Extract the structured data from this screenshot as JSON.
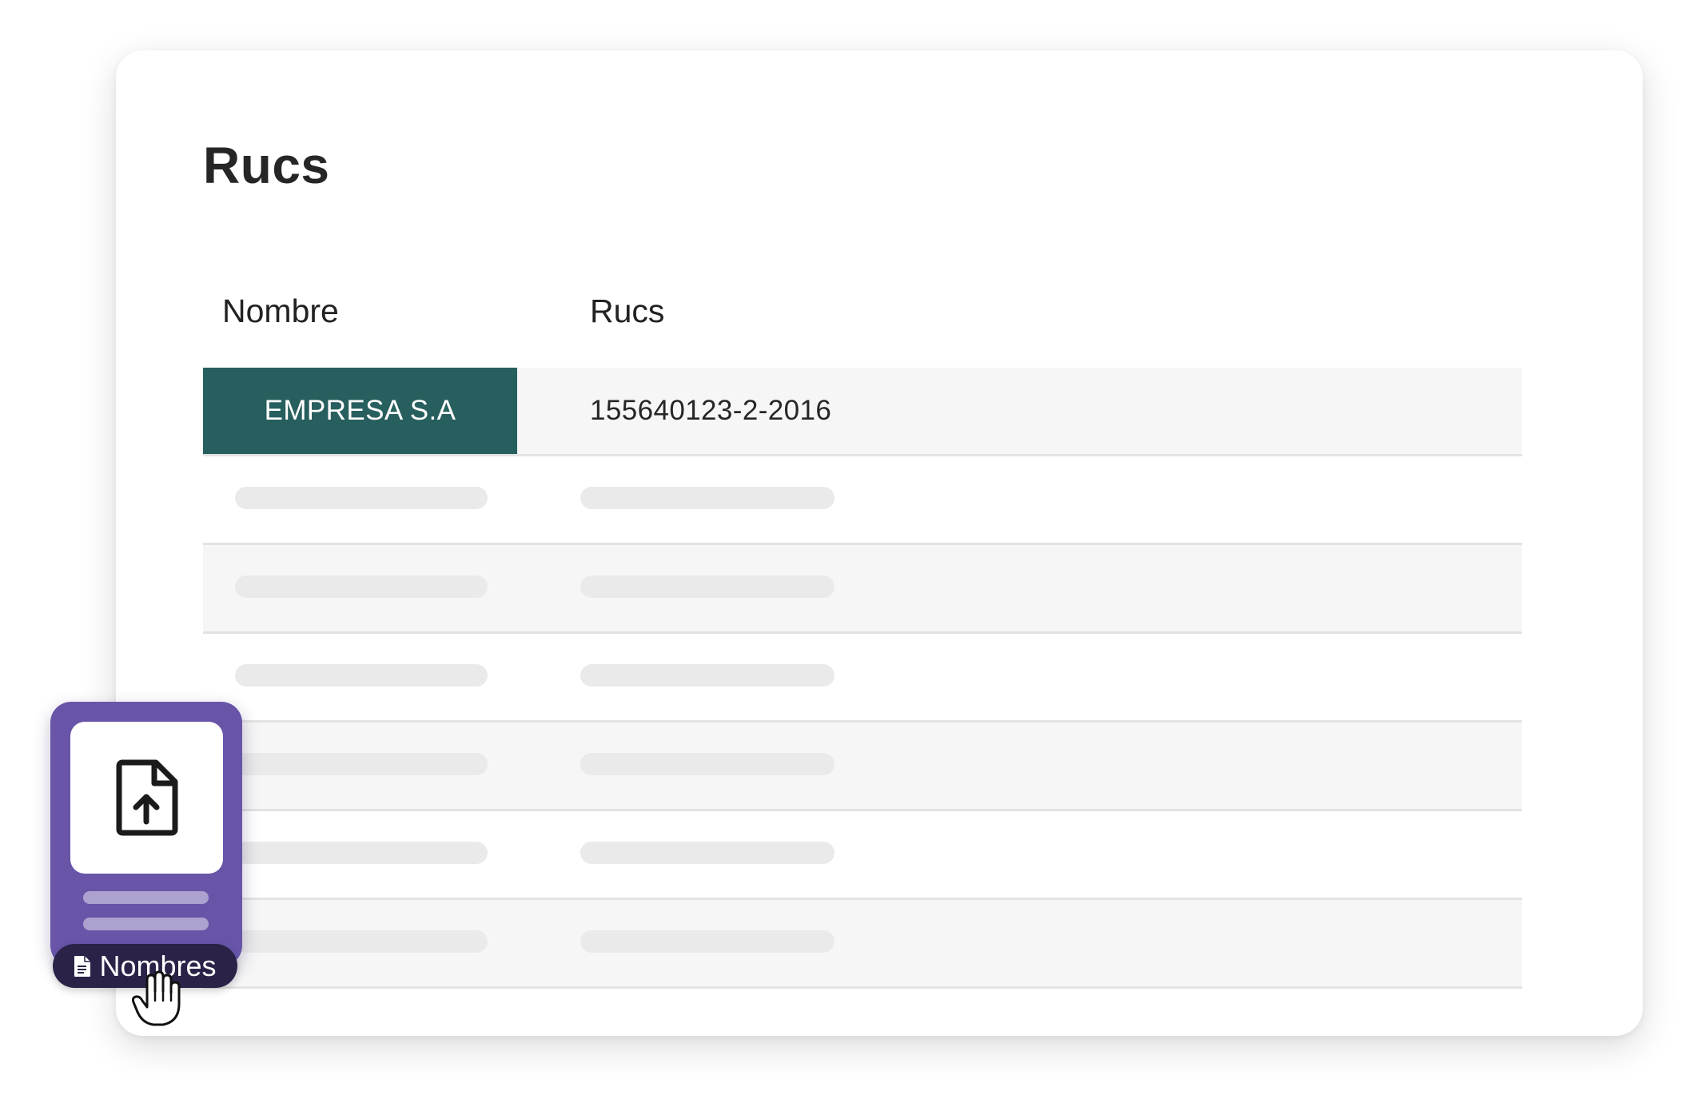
{
  "page": {
    "title": "Rucs"
  },
  "table": {
    "columns": [
      "Nombre",
      "Rucs"
    ],
    "selected_row": {
      "nombre": "EMPRESA S.A",
      "ruc": "155640123-2-2016"
    },
    "placeholder_row_count": 6
  },
  "upload": {
    "icon": "file-upload-icon",
    "label": "Nombres",
    "label_icon": "document-icon"
  },
  "cursor": {
    "icon": "hand-pointer-icon"
  },
  "colors": {
    "selected_cell": "#275f5e",
    "upload_widget": "#6855a8",
    "upload_label": "#2b2248"
  }
}
